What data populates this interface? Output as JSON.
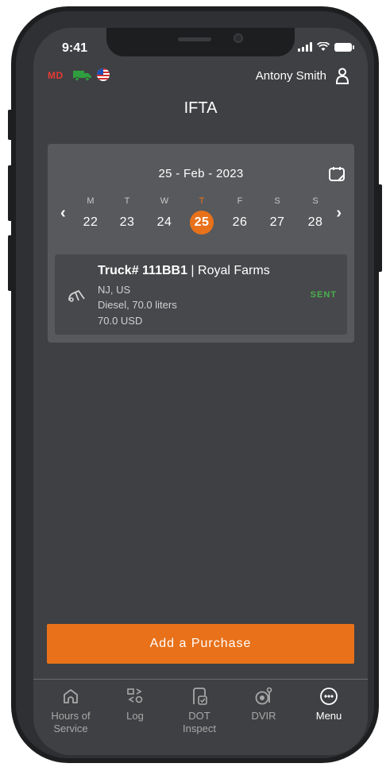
{
  "status_bar": {
    "time": "9:41"
  },
  "header": {
    "md_badge": "MD",
    "user_name": "Antony Smith",
    "title": "IFTA"
  },
  "calendar": {
    "date_label": "25 - Feb - 2023",
    "days": [
      {
        "weekday": "M",
        "num": "22"
      },
      {
        "weekday": "T",
        "num": "23"
      },
      {
        "weekday": "W",
        "num": "24"
      },
      {
        "weekday": "T",
        "num": "25"
      },
      {
        "weekday": "F",
        "num": "26"
      },
      {
        "weekday": "S",
        "num": "27"
      },
      {
        "weekday": "S",
        "num": "28"
      }
    ],
    "selected_index": 3,
    "prev_label": "‹",
    "next_label": "›"
  },
  "entry": {
    "truck_label": "Truck# 111BB1",
    "separator": "|",
    "vendor": "Royal Farms",
    "location": "NJ, US",
    "fuel": "Diesel, 70.0 liters",
    "amount": "70.0 USD",
    "status": "SENT"
  },
  "actions": {
    "add_purchase": "Add a Purchase"
  },
  "nav": [
    {
      "label": "Hours of Service",
      "icon": "home-icon"
    },
    {
      "label": "Log",
      "icon": "log-icon"
    },
    {
      "label": "DOT Inspect",
      "icon": "dot-inspect-icon"
    },
    {
      "label": "DVIR",
      "icon": "dvir-icon"
    },
    {
      "label": "Menu",
      "icon": "menu-icon"
    }
  ],
  "colors": {
    "accent": "#e8711a",
    "sent": "#4caf50",
    "md": "#e53935",
    "truck": "#2e9e3e"
  }
}
